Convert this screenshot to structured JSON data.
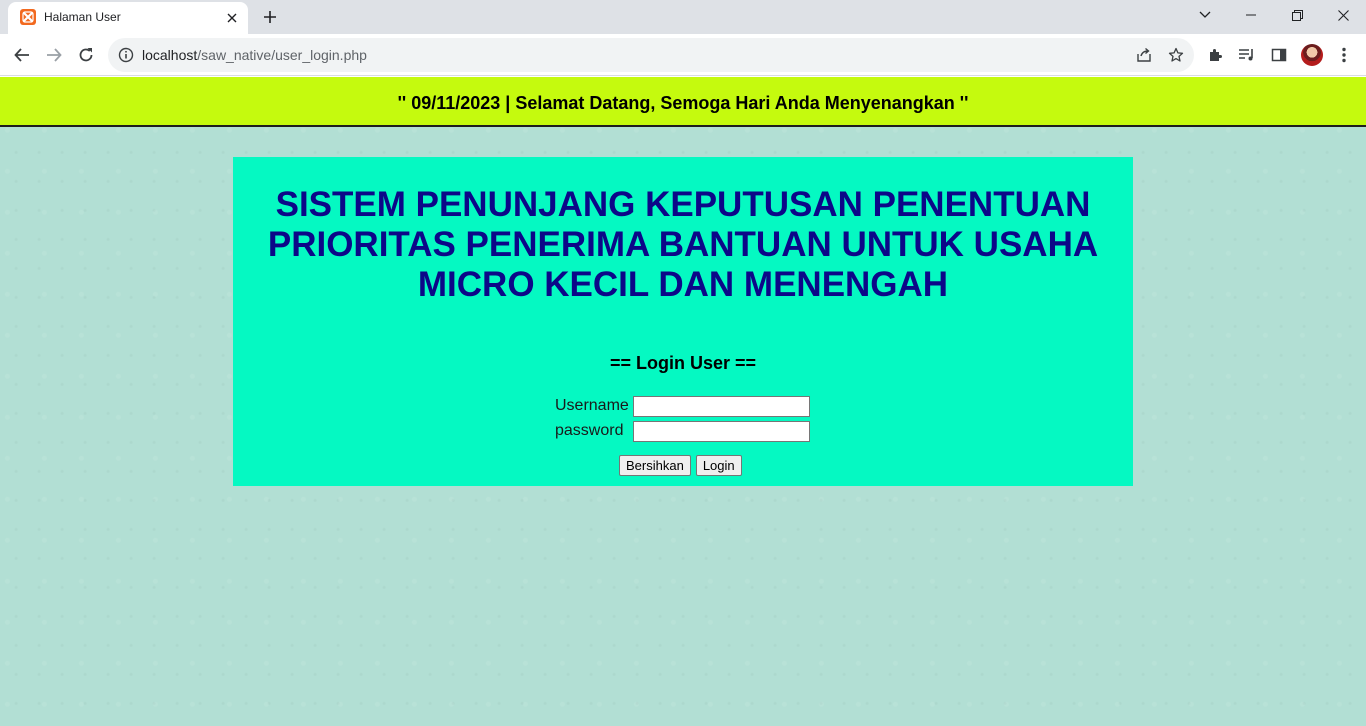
{
  "browser": {
    "tab_title": "Halaman User",
    "url_host": "localhost",
    "url_path": "/saw_native/user_login.php"
  },
  "page": {
    "banner_text": "'' 09/11/2023 | Selamat Datang, Semoga Hari Anda Menyenangkan ''",
    "title_lines": [
      "SISTEM PENUNJANG KEPUTUSAN PENENTUAN",
      "PRIORITAS PENERIMA BANTUAN UNTUK USAHA",
      "MICRO KECIL DAN MENENGAH"
    ],
    "login_heading": "== Login User ==",
    "username_label": "Username",
    "password_label": "password",
    "username_value": "",
    "password_value": "",
    "clear_button": "Bersihkan",
    "login_button": "Login"
  },
  "colors": {
    "banner_bg": "#c5fa0e",
    "panel_bg": "#05f9c2",
    "title_color": "#0c0788",
    "page_bg": "#b2dfd4"
  }
}
